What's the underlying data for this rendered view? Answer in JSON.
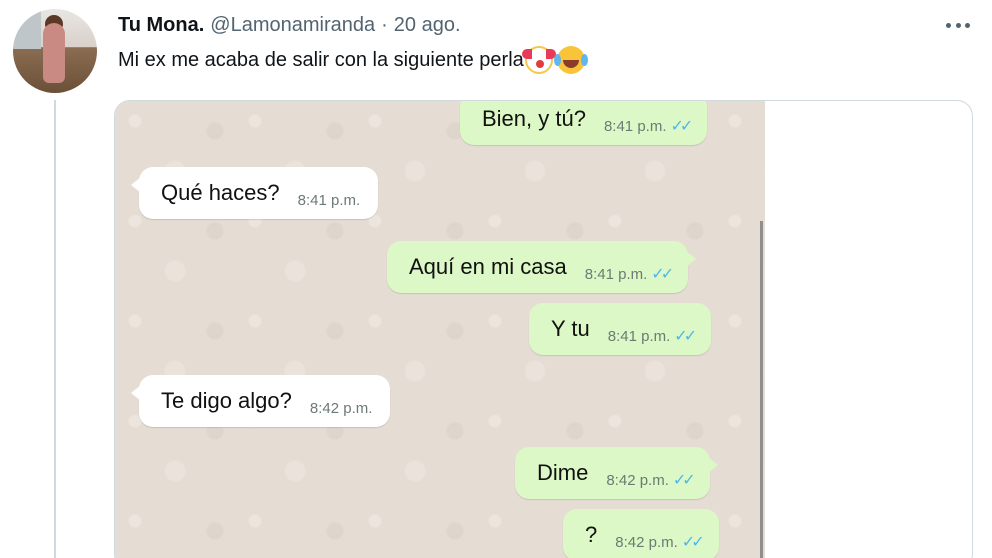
{
  "tweet": {
    "author_name": "Tu Mona.",
    "handle": "@Lamonamiranda",
    "separator": "·",
    "date": "20 ago.",
    "text": "Mi ex me acaba de salir con la siguiente perla",
    "emojis": [
      "clown-face-emoji",
      "face-with-tears-of-joy-emoji"
    ],
    "more_icon": "more-horizontal-icon"
  },
  "chat": {
    "messages": [
      {
        "direction": "out",
        "text": "Bien, y tú?",
        "time": "8:41 p.m.",
        "read": true
      },
      {
        "direction": "in",
        "text": "Qué haces?",
        "time": "8:41 p.m."
      },
      {
        "direction": "out",
        "text": "Aquí en mi casa",
        "time": "8:41 p.m.",
        "read": true
      },
      {
        "direction": "out",
        "text": "Y tu",
        "time": "8:41 p.m.",
        "read": true
      },
      {
        "direction": "in",
        "text": "Te digo algo?",
        "time": "8:42 p.m."
      },
      {
        "direction": "out",
        "text": "Dime",
        "time": "8:42 p.m.",
        "read": true
      },
      {
        "direction": "out",
        "text": "?",
        "time": "8:42 p.m.",
        "read": true
      }
    ],
    "colors": {
      "incoming": "#ffffff",
      "outgoing": "#dcf8c6",
      "background": "#e5dcd3",
      "read_ticks": "#4fb6ec"
    }
  }
}
